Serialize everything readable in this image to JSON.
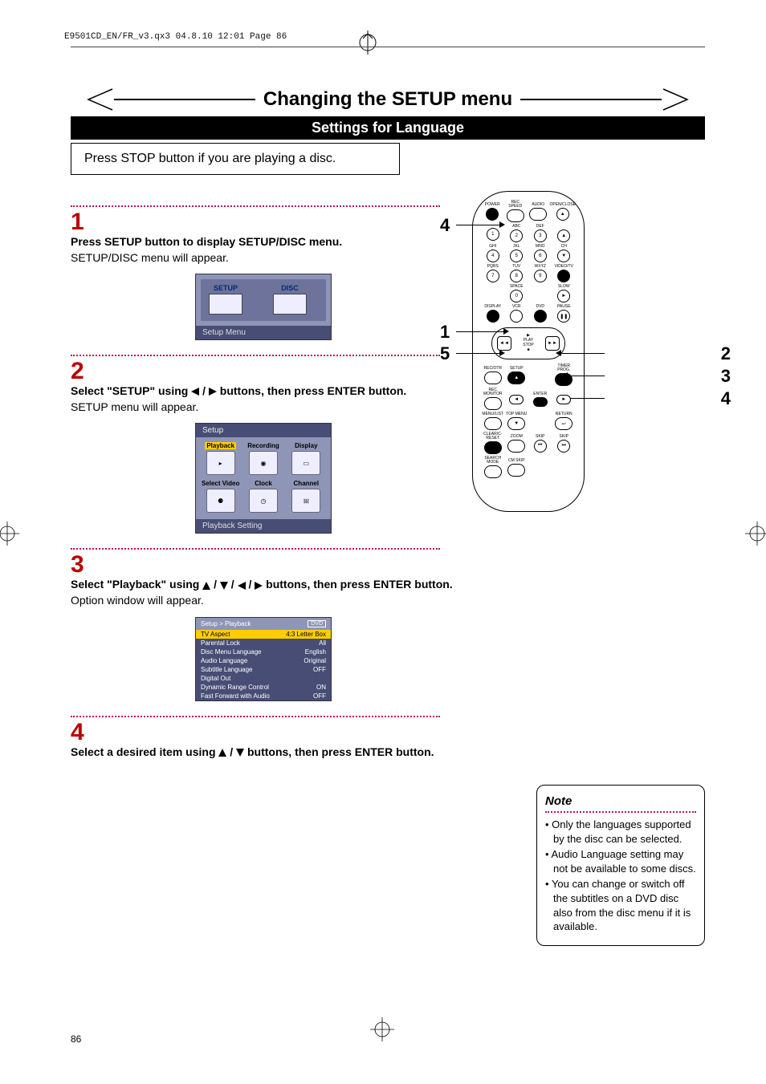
{
  "print_header": "E9501CD_EN/FR_v3.qx3  04.8.10  12:01  Page 86",
  "title": "Changing the SETUP menu",
  "settings_bar": "Settings for Language",
  "stop_note": "Press STOP button if you are playing a disc.",
  "steps": {
    "s1": {
      "num": "1",
      "bold": "Press SETUP button to display SETUP/DISC menu.",
      "body": "SETUP/DISC menu will appear."
    },
    "s2": {
      "num": "2",
      "pre": "Select \"SETUP\" using ",
      "mid": " / ",
      "post": " buttons, then press ENTER button.",
      "body": "SETUP menu will appear."
    },
    "s3": {
      "num": "3",
      "pre": "Select \"Playback\" using ",
      "sep": " / ",
      "post": " buttons, then press ENTER button.",
      "body": "Option window will appear."
    },
    "s4": {
      "num": "4",
      "pre": "Select a desired item using ",
      "sep": " / ",
      "post": " buttons, then press ENTER button."
    }
  },
  "osd1": {
    "setup": "SETUP",
    "disc": "DISC",
    "foot": "Setup Menu"
  },
  "osd2": {
    "hdr": "Setup",
    "cells": [
      "Playback",
      "Recording",
      "Display",
      "Select Video",
      "Clock",
      "Channel"
    ],
    "foot": "Playback Setting"
  },
  "osd3": {
    "hdr": "Setup > Playback",
    "dvd": "DVD",
    "rows": [
      {
        "k": "TV Aspect",
        "v": "4:3 Letter Box",
        "hi": true
      },
      {
        "k": "Parental Lock",
        "v": "All"
      },
      {
        "k": "Disc Menu Language",
        "v": "English"
      },
      {
        "k": "Audio Language",
        "v": "Original"
      },
      {
        "k": "Subtitle Language",
        "v": "OFF"
      },
      {
        "k": "Digital Out",
        "v": ""
      },
      {
        "k": "Dynamic Range Control",
        "v": "ON"
      },
      {
        "k": "Fast Forward with Audio",
        "v": "OFF"
      }
    ]
  },
  "remote": {
    "row1": [
      "POWER",
      "REC SPEED",
      "AUDIO",
      "OPEN/CLOSE"
    ],
    "row2_lbl": [
      "",
      "ABC",
      "DEF",
      ""
    ],
    "row2": [
      "1",
      "2",
      "3",
      "▲"
    ],
    "row3_lbl": [
      "GHI",
      "JKL",
      "MNO",
      "CH"
    ],
    "row3": [
      "4",
      "5",
      "6",
      "▼"
    ],
    "row4_lbl": [
      "PQRS",
      "TUV",
      "WXYZ",
      "VIDEO/TV"
    ],
    "row4": [
      "7",
      "8",
      "9",
      "●"
    ],
    "row5_lbl": [
      "",
      "SPACE",
      "",
      "SLOW"
    ],
    "row5": [
      "",
      "0",
      "",
      "►"
    ],
    "row6_lbl": [
      "DISPLAY",
      "VCR",
      "DVD",
      "PAUSE"
    ],
    "row6": [
      "●",
      "vcr",
      "dvd",
      "❚❚"
    ],
    "play": {
      "rev": "◄◄",
      "play": "PLAY",
      "fwd": "►►",
      "stop": "STOP"
    },
    "row7_lbl": [
      "REC/OTR",
      "SETUP",
      "",
      "TIMER PROG."
    ],
    "row8_lbl": [
      "REC MONITOR",
      "",
      "ENTER",
      ""
    ],
    "row9_lbl": [
      "MENU/LIST",
      "TOP MENU",
      "",
      "RETURN"
    ],
    "row10_lbl": [
      "CLEAR/C-RESET",
      "ZOOM",
      "SKIP",
      "SKIP"
    ],
    "row11_lbl": [
      "SEARCH MODE",
      "CM SKIP",
      "",
      ""
    ]
  },
  "callouts": {
    "l": [
      "4",
      "1",
      "5"
    ],
    "r": [
      "2",
      "3",
      "4"
    ]
  },
  "note": {
    "title": "Note",
    "items": [
      "Only the languages supported by the disc can be selected.",
      "Audio Language setting may not be available to some discs.",
      "You can change or switch off the subtitles on a DVD disc also from the disc menu if it is available."
    ]
  },
  "page_number": "86"
}
